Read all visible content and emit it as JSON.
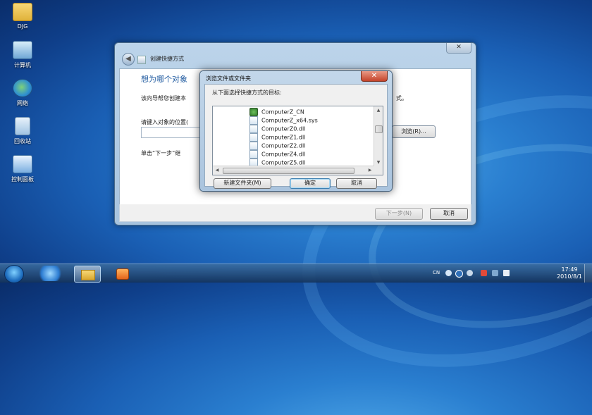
{
  "desktop": {
    "icons": [
      {
        "label": "DJG",
        "icon": "folder-icon"
      },
      {
        "label": "计算机",
        "icon": "computer-icon"
      },
      {
        "label": "网络",
        "icon": "network-icon"
      },
      {
        "label": "回收站",
        "icon": "recycle-bin-icon"
      },
      {
        "label": "控制面板",
        "icon": "control-panel-icon"
      }
    ]
  },
  "wizard": {
    "title": "创建快捷方式",
    "heading": "想为哪个对象",
    "description": "该向导帮您创建本",
    "description_tail": "式。",
    "location_label": "请键入对象的位置(",
    "browse_label": "浏览(R)...",
    "hint": "单击“下一步”继",
    "next_label": "下一步(N)",
    "cancel_label": "取消",
    "close_glyph": "✕",
    "back_glyph": "◀"
  },
  "browse_dialog": {
    "title": "浏览文件或文件夹",
    "label": "从下面选择快捷方式的目标:",
    "items": [
      {
        "name": "ComputerZ_CN",
        "icon": "application-icon"
      },
      {
        "name": "ComputerZ_x64.sys",
        "icon": "system-file-icon"
      },
      {
        "name": "ComputerZ0.dll",
        "icon": "dll-file-icon"
      },
      {
        "name": "ComputerZ1.dll",
        "icon": "dll-file-icon"
      },
      {
        "name": "ComputerZ2.dll",
        "icon": "dll-file-icon"
      },
      {
        "name": "ComputerZ4.dll",
        "icon": "dll-file-icon"
      },
      {
        "name": "ComputerZ5.dll",
        "icon": "dll-file-icon"
      }
    ],
    "new_folder_label": "新建文件夹(M)",
    "ok_label": "确定",
    "cancel_label": "取消",
    "close_glyph": "✕"
  },
  "taskbar": {
    "input_lang": "CN",
    "time": "17:49",
    "date": "2010/8/1"
  },
  "colors": {
    "heading": "#1f5aa0",
    "close_red": "#c4432a"
  }
}
